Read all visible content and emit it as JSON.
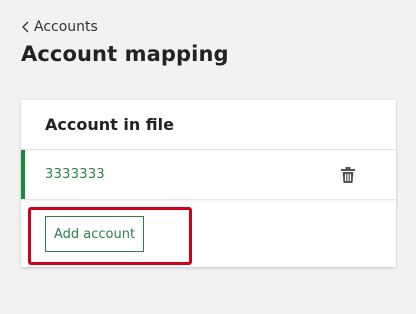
{
  "nav": {
    "back_label": "Accounts"
  },
  "page": {
    "title": "Account mapping"
  },
  "panel": {
    "header": "Account in file",
    "accounts": [
      {
        "value": "3333333"
      }
    ],
    "add_button_label": "Add account"
  },
  "colors": {
    "accent_green": "#1a8a3e",
    "text_green": "#2e7d4f",
    "highlight_red": "#d0021b",
    "background": "#f2f2f2"
  },
  "icons": {
    "back": "chevron-left-icon",
    "delete": "trash-icon"
  }
}
